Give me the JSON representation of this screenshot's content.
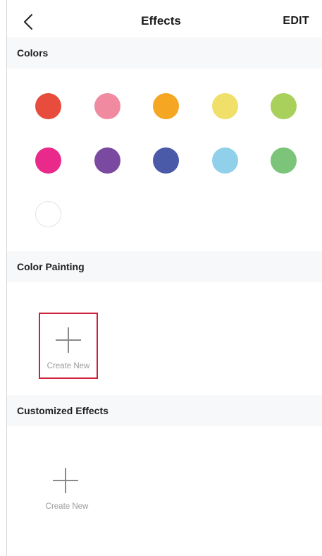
{
  "nav": {
    "back_icon": "chevron-left-icon",
    "title": "Effects",
    "edit_label": "EDIT"
  },
  "sections": {
    "colors": {
      "title": "Colors"
    },
    "color_painting": {
      "title": "Color Painting",
      "create_label": "Create New",
      "plus_icon": "plus-icon"
    },
    "customized_effects": {
      "title": "Customized Effects",
      "create_label": "Create New",
      "plus_icon": "plus-icon"
    }
  },
  "swatch_colors": [
    "#e84c3d",
    "#f08aa0",
    "#f5a623",
    "#f0e06a",
    "#a8d05a",
    "#ea2a8a",
    "#7a4aa0",
    "#4a5aa8",
    "#90d0ea",
    "#7cc47a",
    "#ffffff"
  ],
  "accent": {
    "selection_border": "#d0203a"
  }
}
